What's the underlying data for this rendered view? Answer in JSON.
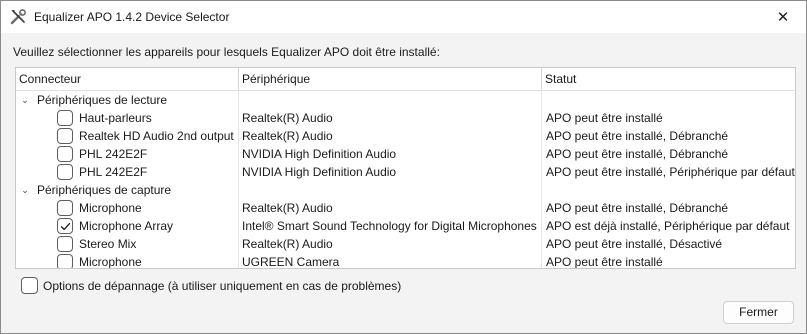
{
  "window": {
    "title": "Equalizer APO 1.4.2 Device Selector",
    "icon": "tools-icon",
    "close_glyph": "✕"
  },
  "instruction": "Veuillez sélectionner les appareils pour lesquels Equalizer APO doit être installé:",
  "table": {
    "columns": [
      "Connecteur",
      "Périphérique",
      "Statut"
    ],
    "groups": [
      {
        "label": "Périphériques de lecture",
        "expanded": true,
        "rows": [
          {
            "connector": "Haut-parleurs",
            "device": "Realtek(R) Audio",
            "status": "APO peut être installé",
            "checked": false
          },
          {
            "connector": "Realtek HD Audio 2nd output",
            "device": "Realtek(R) Audio",
            "status": "APO peut être installé, Débranché",
            "checked": false
          },
          {
            "connector": "PHL 242E2F",
            "device": "NVIDIA High Definition Audio",
            "status": "APO peut être installé, Débranché",
            "checked": false
          },
          {
            "connector": "PHL 242E2F",
            "device": "NVIDIA High Definition Audio",
            "status": "APO peut être installé, Périphérique par défaut",
            "checked": false
          }
        ]
      },
      {
        "label": "Périphériques de capture",
        "expanded": true,
        "rows": [
          {
            "connector": "Microphone",
            "device": "Realtek(R) Audio",
            "status": "APO peut être installé, Débranché",
            "checked": false
          },
          {
            "connector": "Microphone Array",
            "device": "Intel® Smart Sound Technology for Digital Microphones",
            "status": "APO est déjà installé, Périphérique par défaut",
            "checked": true
          },
          {
            "connector": "Stereo Mix",
            "device": "Realtek(R) Audio",
            "status": "APO peut être installé, Désactivé",
            "checked": false
          },
          {
            "connector": "Microphone",
            "device": "UGREEN Camera",
            "status": "APO peut être installé",
            "checked": false
          }
        ]
      }
    ]
  },
  "troubleshoot": {
    "label": "Options de dépannage (à utiliser uniquement en cas de problèmes)",
    "checked": false
  },
  "buttons": {
    "close": "Fermer"
  },
  "colors": {
    "check": "#1a1a1a",
    "accent": "#005fb8"
  }
}
